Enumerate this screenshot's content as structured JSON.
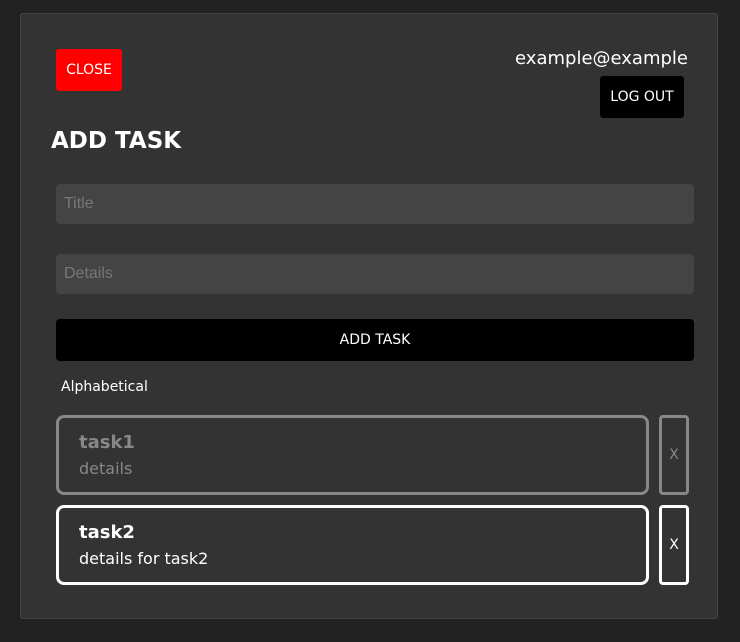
{
  "header": {
    "close_label": "CLOSE",
    "user_email": "example@example",
    "logout_label": "LOG OUT"
  },
  "form": {
    "heading": "ADD TASK",
    "title_placeholder": "Title",
    "details_placeholder": "Details",
    "submit_label": "ADD TASK"
  },
  "sort": {
    "label": "Alphabetical"
  },
  "tasks": [
    {
      "title": "task1",
      "details": "details",
      "completed": true,
      "delete_label": "X"
    },
    {
      "title": "task2",
      "details": "details for task2",
      "completed": false,
      "delete_label": "X"
    }
  ],
  "colors": {
    "page_background": "#222222",
    "panel_background": "#333333",
    "close_button": "#ff0000",
    "primary_button": "#000000",
    "input_background": "#444444",
    "completed_task": "#888888",
    "active_task": "#ffffff"
  }
}
